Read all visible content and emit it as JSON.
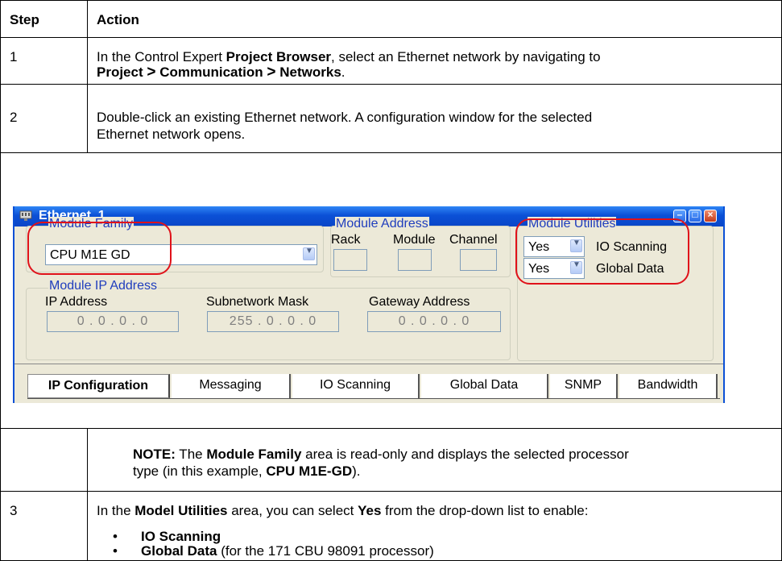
{
  "table": {
    "header": {
      "step": "Step",
      "action": "Action"
    },
    "rows": [
      {
        "step": "1",
        "a1": "In the Control Expert ",
        "a1b": "Project Browser",
        "a1c": ", select an Ethernet network by navigating to",
        "p1": "Project",
        "p2": "Communication",
        "p3": "Networks",
        "arrow": ">",
        "end": "."
      },
      {
        "step": "2",
        "line1": "Double-click an existing Ethernet network. A configuration window for the selected",
        "line2": "Ethernet network opens."
      },
      {
        "note_label": "NOTE:",
        "note_t1": " The ",
        "note_b1": "Module Family",
        "note_t2": " area is read-only and displays the selected processor",
        "note_line2a": "type (in this example, ",
        "note_b2": "CPU M1E-GD",
        "note_line2b": ")."
      },
      {
        "step": "3",
        "t1": "In the ",
        "b1": "Model Utilities",
        "t2": " area, you can select ",
        "b2": "Yes",
        "t3": " from the drop-down list to enable:",
        "bullet": "•",
        "item1": "IO Scanning",
        "item2b": "Global Data",
        "item2": " (for the 171 CBU 98091 processor)"
      }
    ]
  },
  "window": {
    "title": "Ethernet_1",
    "buttons": {
      "minimize": "minimize-icon",
      "maximize": "maximize-icon",
      "close": "close-icon"
    },
    "module_family": {
      "label": "Module Family",
      "value": "CPU M1E GD"
    },
    "module_address": {
      "label": "Module Address",
      "rack": "Rack",
      "module": "Module",
      "channel": "Channel"
    },
    "module_utilities": {
      "label": "Module Utilities",
      "io_value": "Yes",
      "io_label": "IO Scanning",
      "gd_value": "Yes",
      "gd_label": "Global Data"
    },
    "ip": {
      "group": "Module IP Address",
      "ip_label": "IP Address",
      "ip_value": "0 . 0 . 0 . 0",
      "mask_label": "Subnetwork Mask",
      "mask_value": "255 . 0 . 0 . 0",
      "gw_label": "Gateway Address",
      "gw_value": "0 . 0 . 0 . 0"
    },
    "tabs": [
      "IP Configuration",
      "Messaging",
      "IO Scanning",
      "Global Data",
      "SNMP",
      "Bandwidth"
    ],
    "highlight_color": "#e0121a"
  }
}
